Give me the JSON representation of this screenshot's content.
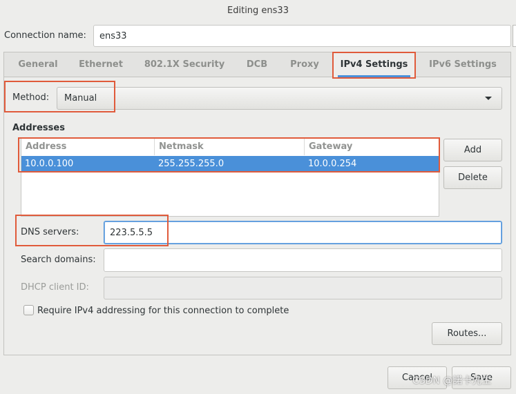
{
  "window": {
    "title": "Editing ens33"
  },
  "connection": {
    "label": "Connection name:",
    "value": "ens33"
  },
  "tabs": [
    {
      "label": "General"
    },
    {
      "label": "Ethernet"
    },
    {
      "label": "802.1X Security"
    },
    {
      "label": "DCB"
    },
    {
      "label": "Proxy"
    },
    {
      "label": "IPv4 Settings"
    },
    {
      "label": "IPv6 Settings"
    }
  ],
  "active_tab": "IPv4 Settings",
  "method": {
    "label": "Method:",
    "value": "Manual"
  },
  "addresses": {
    "label": "Addresses",
    "columns": [
      "Address",
      "Netmask",
      "Gateway"
    ],
    "rows": [
      {
        "address": "10.0.0.100",
        "netmask": "255.255.255.0",
        "gateway": "10.0.0.254",
        "selected": true
      }
    ],
    "add_label": "Add",
    "delete_label": "Delete"
  },
  "dns": {
    "label": "DNS servers:",
    "value": "223.5.5.5"
  },
  "search_domains": {
    "label": "Search domains:",
    "value": ""
  },
  "dhcp_client_id": {
    "label": "DHCP client ID:",
    "value": ""
  },
  "require_ipv4": {
    "label": "Require IPv4 addressing for this connection to complete",
    "checked": false
  },
  "routes_label": "Routes...",
  "footer": {
    "cancel_label": "Cancel",
    "save_label": "Save"
  },
  "watermark": "CSDN @諾卡先生",
  "colors": {
    "accent": "#4a90d9",
    "highlight": "#e05a3a",
    "background": "#ededeb"
  }
}
